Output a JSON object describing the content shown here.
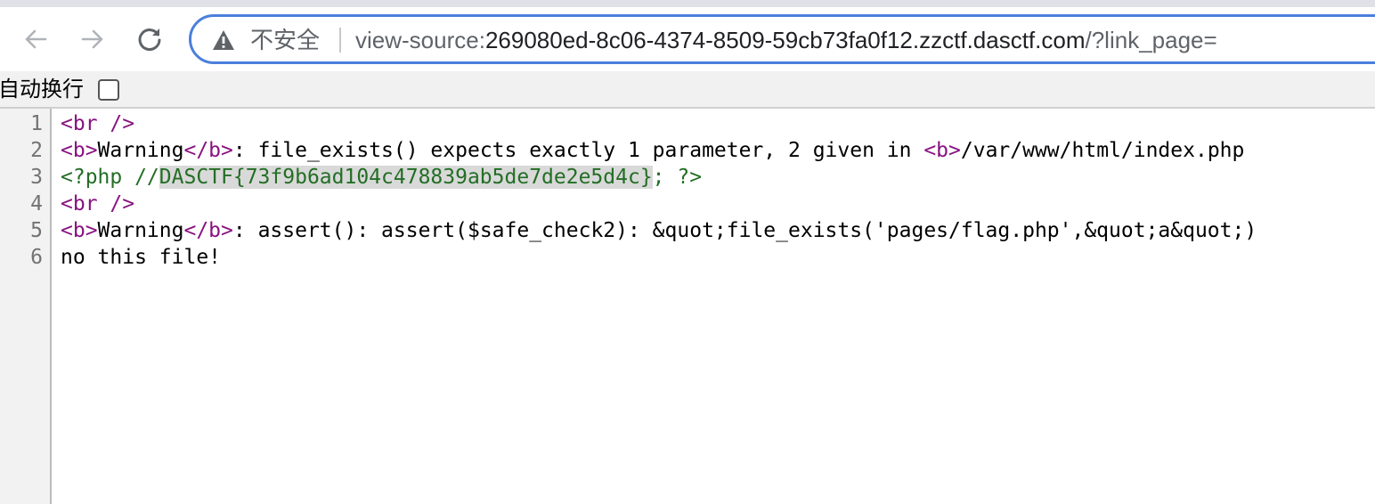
{
  "toolbar": {
    "back_icon": "arrow-left-icon",
    "forward_icon": "arrow-right-icon",
    "reload_icon": "reload-icon",
    "security_icon": "warning-triangle-icon",
    "security_label": "不安全",
    "url_scheme": "view-source:",
    "url_host": "269080ed-8c06-4374-8509-59cb73fa0f12.zzctf.dasctf.com",
    "url_path": "/?link_page="
  },
  "source_view": {
    "wrap_label": "自动换行",
    "wrap_checked": false,
    "lines": [
      {
        "number": "1",
        "parts": {
          "a": "<br />"
        }
      },
      {
        "number": "2",
        "parts": {
          "a": "<b>",
          "b": "Warning",
          "c": "</b>",
          "d": ":  file_exists() expects exactly 1 parameter, 2 given in ",
          "e": "<b>",
          "f": "/var/www/html/index.php"
        }
      },
      {
        "number": "3",
        "parts": {
          "a": "<?php //",
          "b": "DASCTF{73f9b6ad104c478839ab5de7de2e5d4c}",
          "c": "; ?>"
        }
      },
      {
        "number": "4",
        "parts": {
          "a": "<br />"
        }
      },
      {
        "number": "5",
        "parts": {
          "a": "<b>",
          "b": "Warning",
          "c": "</b>",
          "d": ":  assert(): assert($safe_check2): &quot;file_exists('pages/flag.php',&quot;a&quot;)"
        }
      },
      {
        "number": "6",
        "parts": {
          "a": "no this file!"
        }
      }
    ]
  },
  "colors": {
    "omnibox_border": "#4a7fdc",
    "tag": "#881280",
    "php_comment": "#236e25",
    "selection": "#d9d9d9"
  }
}
